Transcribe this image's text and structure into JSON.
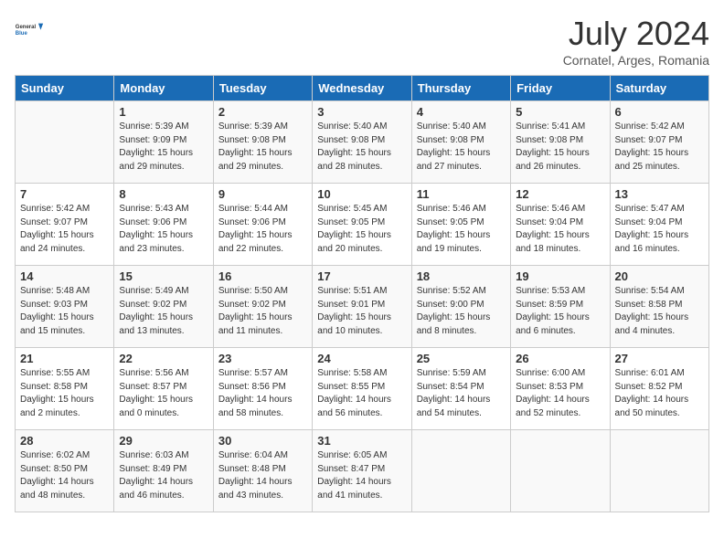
{
  "header": {
    "logo_line1": "General",
    "logo_line2": "Blue",
    "month": "July 2024",
    "location": "Cornatel, Arges, Romania"
  },
  "days_of_week": [
    "Sunday",
    "Monday",
    "Tuesday",
    "Wednesday",
    "Thursday",
    "Friday",
    "Saturday"
  ],
  "weeks": [
    [
      {
        "day": "",
        "info": ""
      },
      {
        "day": "1",
        "info": "Sunrise: 5:39 AM\nSunset: 9:09 PM\nDaylight: 15 hours\nand 29 minutes."
      },
      {
        "day": "2",
        "info": "Sunrise: 5:39 AM\nSunset: 9:08 PM\nDaylight: 15 hours\nand 29 minutes."
      },
      {
        "day": "3",
        "info": "Sunrise: 5:40 AM\nSunset: 9:08 PM\nDaylight: 15 hours\nand 28 minutes."
      },
      {
        "day": "4",
        "info": "Sunrise: 5:40 AM\nSunset: 9:08 PM\nDaylight: 15 hours\nand 27 minutes."
      },
      {
        "day": "5",
        "info": "Sunrise: 5:41 AM\nSunset: 9:08 PM\nDaylight: 15 hours\nand 26 minutes."
      },
      {
        "day": "6",
        "info": "Sunrise: 5:42 AM\nSunset: 9:07 PM\nDaylight: 15 hours\nand 25 minutes."
      }
    ],
    [
      {
        "day": "7",
        "info": "Sunrise: 5:42 AM\nSunset: 9:07 PM\nDaylight: 15 hours\nand 24 minutes."
      },
      {
        "day": "8",
        "info": "Sunrise: 5:43 AM\nSunset: 9:06 PM\nDaylight: 15 hours\nand 23 minutes."
      },
      {
        "day": "9",
        "info": "Sunrise: 5:44 AM\nSunset: 9:06 PM\nDaylight: 15 hours\nand 22 minutes."
      },
      {
        "day": "10",
        "info": "Sunrise: 5:45 AM\nSunset: 9:05 PM\nDaylight: 15 hours\nand 20 minutes."
      },
      {
        "day": "11",
        "info": "Sunrise: 5:46 AM\nSunset: 9:05 PM\nDaylight: 15 hours\nand 19 minutes."
      },
      {
        "day": "12",
        "info": "Sunrise: 5:46 AM\nSunset: 9:04 PM\nDaylight: 15 hours\nand 18 minutes."
      },
      {
        "day": "13",
        "info": "Sunrise: 5:47 AM\nSunset: 9:04 PM\nDaylight: 15 hours\nand 16 minutes."
      }
    ],
    [
      {
        "day": "14",
        "info": "Sunrise: 5:48 AM\nSunset: 9:03 PM\nDaylight: 15 hours\nand 15 minutes."
      },
      {
        "day": "15",
        "info": "Sunrise: 5:49 AM\nSunset: 9:02 PM\nDaylight: 15 hours\nand 13 minutes."
      },
      {
        "day": "16",
        "info": "Sunrise: 5:50 AM\nSunset: 9:02 PM\nDaylight: 15 hours\nand 11 minutes."
      },
      {
        "day": "17",
        "info": "Sunrise: 5:51 AM\nSunset: 9:01 PM\nDaylight: 15 hours\nand 10 minutes."
      },
      {
        "day": "18",
        "info": "Sunrise: 5:52 AM\nSunset: 9:00 PM\nDaylight: 15 hours\nand 8 minutes."
      },
      {
        "day": "19",
        "info": "Sunrise: 5:53 AM\nSunset: 8:59 PM\nDaylight: 15 hours\nand 6 minutes."
      },
      {
        "day": "20",
        "info": "Sunrise: 5:54 AM\nSunset: 8:58 PM\nDaylight: 15 hours\nand 4 minutes."
      }
    ],
    [
      {
        "day": "21",
        "info": "Sunrise: 5:55 AM\nSunset: 8:58 PM\nDaylight: 15 hours\nand 2 minutes."
      },
      {
        "day": "22",
        "info": "Sunrise: 5:56 AM\nSunset: 8:57 PM\nDaylight: 15 hours\nand 0 minutes."
      },
      {
        "day": "23",
        "info": "Sunrise: 5:57 AM\nSunset: 8:56 PM\nDaylight: 14 hours\nand 58 minutes."
      },
      {
        "day": "24",
        "info": "Sunrise: 5:58 AM\nSunset: 8:55 PM\nDaylight: 14 hours\nand 56 minutes."
      },
      {
        "day": "25",
        "info": "Sunrise: 5:59 AM\nSunset: 8:54 PM\nDaylight: 14 hours\nand 54 minutes."
      },
      {
        "day": "26",
        "info": "Sunrise: 6:00 AM\nSunset: 8:53 PM\nDaylight: 14 hours\nand 52 minutes."
      },
      {
        "day": "27",
        "info": "Sunrise: 6:01 AM\nSunset: 8:52 PM\nDaylight: 14 hours\nand 50 minutes."
      }
    ],
    [
      {
        "day": "28",
        "info": "Sunrise: 6:02 AM\nSunset: 8:50 PM\nDaylight: 14 hours\nand 48 minutes."
      },
      {
        "day": "29",
        "info": "Sunrise: 6:03 AM\nSunset: 8:49 PM\nDaylight: 14 hours\nand 46 minutes."
      },
      {
        "day": "30",
        "info": "Sunrise: 6:04 AM\nSunset: 8:48 PM\nDaylight: 14 hours\nand 43 minutes."
      },
      {
        "day": "31",
        "info": "Sunrise: 6:05 AM\nSunset: 8:47 PM\nDaylight: 14 hours\nand 41 minutes."
      },
      {
        "day": "",
        "info": ""
      },
      {
        "day": "",
        "info": ""
      },
      {
        "day": "",
        "info": ""
      }
    ]
  ]
}
